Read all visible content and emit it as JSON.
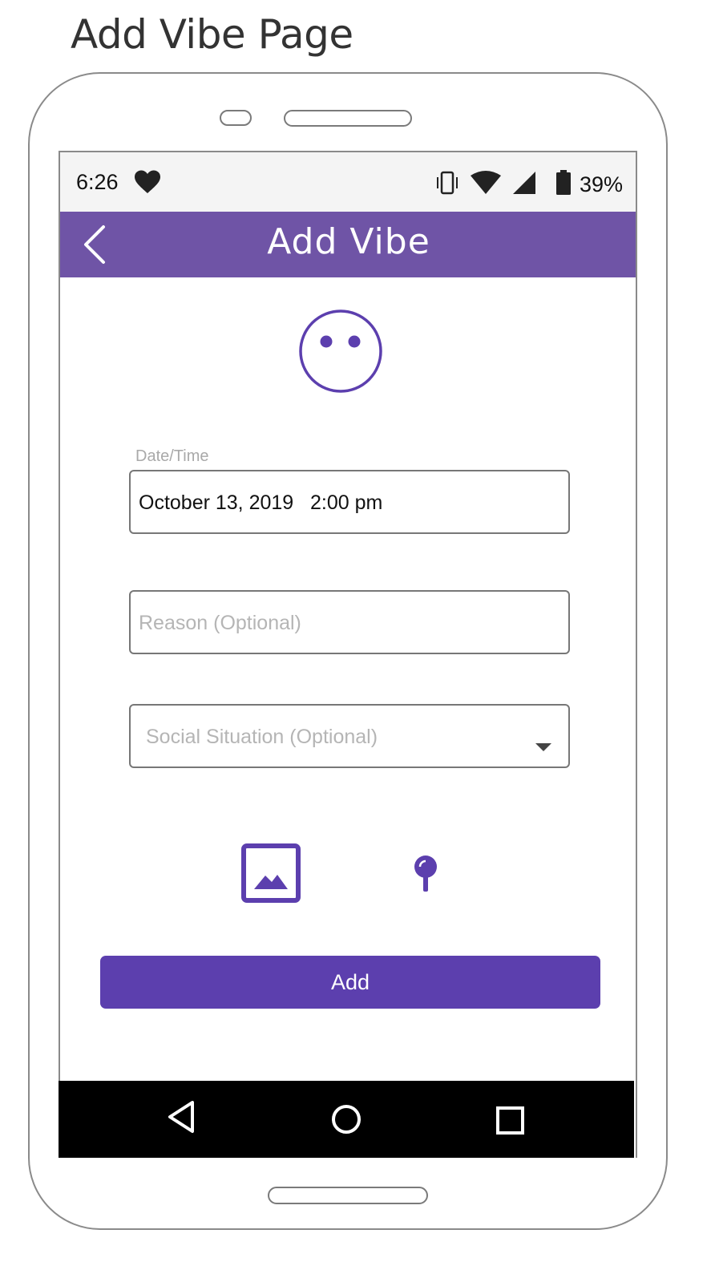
{
  "page_heading": "Add Vibe Page",
  "status_bar": {
    "time": "6:26",
    "battery_percent": "39%",
    "icons": [
      "heart-icon",
      "vibrate-icon",
      "wifi-icon",
      "signal-icon",
      "battery-icon"
    ]
  },
  "app_bar": {
    "title": "Add Vibe",
    "back_icon": "chevron-left-icon",
    "color": "#6f54a6"
  },
  "mood_icon": "neutral-face-icon",
  "form": {
    "datetime": {
      "label": "Date/Time",
      "value": "October 13, 2019   2:00 pm"
    },
    "reason": {
      "placeholder": "Reason (Optional)"
    },
    "social_situation": {
      "placeholder": "Social Situation (Optional)",
      "icon": "caret-down-icon"
    }
  },
  "attachments": {
    "image_icon": "image-icon",
    "location_icon": "location-pin-icon",
    "accent": "#5c3fae"
  },
  "add_button": {
    "label": "Add",
    "color": "#5c3fae"
  },
  "nav_bar": {
    "buttons": [
      "back-triangle-icon",
      "home-circle-icon",
      "recent-square-icon"
    ]
  }
}
